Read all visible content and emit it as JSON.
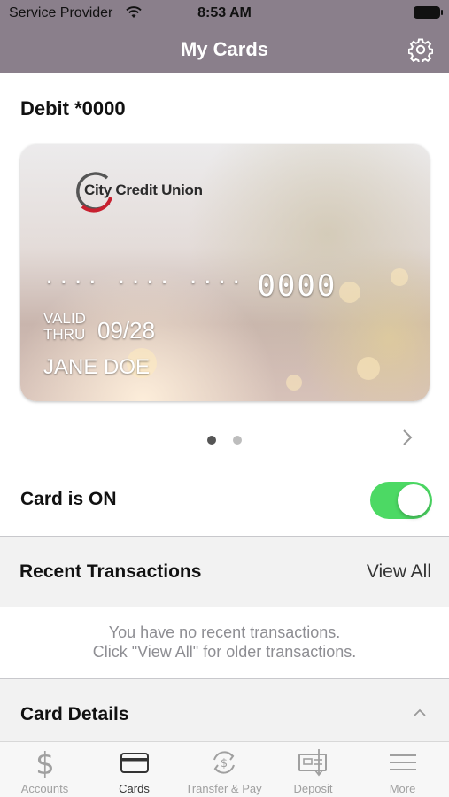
{
  "status_bar": {
    "provider": "Service Provider",
    "time": "8:53 AM",
    "icons": [
      "wifi-icon",
      "battery-icon"
    ]
  },
  "nav": {
    "title": "My Cards",
    "settings_icon": "gear-icon"
  },
  "card": {
    "name": "Debit *0000",
    "issuer": "City Credit Union",
    "masked_number": "···· ···· ····",
    "last_four": "0000",
    "valid_thru_label_1": "VALID",
    "valid_thru_label_2": "THRU",
    "expiry": "09/28",
    "holder": "JANE DOE"
  },
  "pager": {
    "pages": 2,
    "current": 1
  },
  "card_status": {
    "label": "Card is ON",
    "enabled": true
  },
  "recent": {
    "title": "Recent Transactions",
    "view_all": "View All",
    "empty_line_1": "You have no recent transactions.",
    "empty_line_2": "Click \"View All\" for older transactions."
  },
  "details": {
    "title": "Card Details",
    "expanded": true
  },
  "tabs": [
    {
      "label": "Accounts",
      "icon": "dollar-icon",
      "active": false
    },
    {
      "label": "Cards",
      "icon": "card-icon",
      "active": true
    },
    {
      "label": "Transfer & Pay",
      "icon": "transfer-icon",
      "active": false
    },
    {
      "label": "Deposit",
      "icon": "check-deposit-icon",
      "active": false
    },
    {
      "label": "More",
      "icon": "menu-icon",
      "active": false
    }
  ],
  "colors": {
    "header": "#8a7f8b",
    "toggle_on": "#4cd964",
    "section_bg": "#f2f2f2"
  }
}
